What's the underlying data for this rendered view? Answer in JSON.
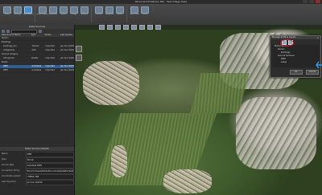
{
  "window": {
    "title": "Personal InfraWorks 360 - Test Village Data"
  },
  "ribbon": {
    "buttons": [
      {
        "label": "Home",
        "icon": "home-icon"
      },
      {
        "label": "Settings",
        "icon": "settings-icon"
      },
      {
        "label": "Data Sources",
        "icon": "data-sources-icon",
        "active": true
      },
      {
        "label": "Model Properties",
        "icon": "model-properties-icon"
      },
      {
        "label": "Proposals",
        "icon": "proposals-icon"
      },
      {
        "label": "Sketch",
        "icon": "sketch-icon"
      },
      {
        "label": "Design",
        "icon": "design-icon"
      },
      {
        "label": "Analyze",
        "icon": "analyze-icon"
      },
      {
        "label": "Present",
        "icon": "present-icon"
      },
      {
        "label": "Storyboard",
        "icon": "storyboard-icon"
      },
      {
        "label": "Render",
        "icon": "render-icon"
      },
      {
        "label": "Point Cloud",
        "icon": "point-cloud-icon"
      },
      {
        "label": "Terrain",
        "icon": "terrain-icon"
      }
    ]
  },
  "sidebar": {
    "title": "Data Sources",
    "columns": [
      "Data Source Name",
      "Type",
      "Status",
      "Last Update"
    ],
    "rows": [
      {
        "name": "Terrain",
        "type": "",
        "status": "",
        "date": "",
        "level": 0
      },
      {
        "name": "Buildings",
        "type": "",
        "status": "",
        "date": "",
        "level": 0
      },
      {
        "name": "buildings_full",
        "type": "Tracker",
        "status": "Imported",
        "date": "Jan Sun 9/2012",
        "level": 1
      },
      {
        "name": "villagesimp",
        "type": "SHP",
        "status": "Imported",
        "date": "Jan Sun 9/2012",
        "level": 1
      },
      {
        "name": "Ground Imagery",
        "type": "",
        "status": "",
        "date": "",
        "level": 0
      },
      {
        "name": "orthophoto",
        "type": "Raster",
        "status": "Imported",
        "date": "Jan Sun 9/2012",
        "level": 1
      },
      {
        "name": "Roads",
        "type": "",
        "status": "",
        "date": "",
        "level": 0
      },
      {
        "name": "DEM",
        "type": "Autodesk",
        "status": "Imported",
        "date": "Jan Sun 9/2012",
        "level": 1,
        "selected": true
      },
      {
        "name": "DEM",
        "type": "Autodesk",
        "status": "Imported",
        "date": "Jan Sun 9/2012",
        "level": 1
      }
    ]
  },
  "properties": {
    "title": "Data Source Details",
    "rows": [
      {
        "key": "Name",
        "value": "DEM"
      },
      {
        "key": "Type",
        "value": "Terrain"
      },
      {
        "key": "Source Type",
        "value": "Autodesk DEM"
      },
      {
        "key": "Connection string",
        "value": "file:///C:/Users/Public/Documents/DataFolder/DEM.tif"
      },
      {
        "key": "Coordinate system",
        "value": "UTM84-32N"
      },
      {
        "key": "Last Imported",
        "value": "Jan Sun 9/2012"
      }
    ]
  },
  "dialog": {
    "title": "Manage Surface Layers",
    "items": [
      {
        "label": "Model Terrain",
        "level": 0
      },
      {
        "label": "Terrain",
        "level": 1
      },
      {
        "label": "Buildings",
        "level": 2
      },
      {
        "label": "Ground Surfaces",
        "level": 1
      },
      {
        "label": "DEM",
        "level": 2
      },
      {
        "label": "Lakes",
        "level": 2
      }
    ],
    "ok_label": "Ok",
    "cancel_label": "Cancel"
  }
}
